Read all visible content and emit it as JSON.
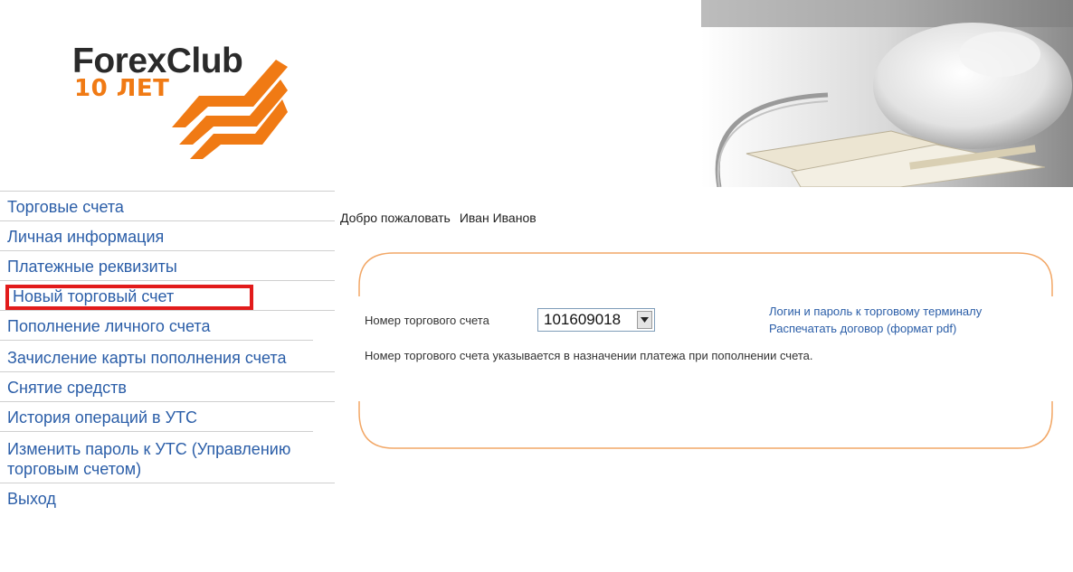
{
  "logo": {
    "brand": "ForexClub",
    "tagline": "10 ЛЕТ"
  },
  "sidebar": {
    "items": [
      {
        "label": "Торговые счета"
      },
      {
        "label": "Личная информация"
      },
      {
        "label": "Платежные реквизиты"
      },
      {
        "label": "Новый торговый счет"
      },
      {
        "label": "Пополнение личного счета"
      },
      {
        "label": "Зачисление карты пополнения счета"
      },
      {
        "label": "Снятие средств"
      },
      {
        "label": "История операций в УТС"
      },
      {
        "label": "Изменить пароль к УТС (Управлению торговым счетом)"
      },
      {
        "label": "Выход"
      }
    ]
  },
  "welcome": {
    "label": "Добро пожаловать",
    "user": "Иван Иванов"
  },
  "account": {
    "label": "Номер торгового счета",
    "selected": "101609018",
    "hint": "Номер торгового счета указывается в назначении платежа при пополнении счета."
  },
  "links": {
    "terminal": "Логин и пароль к торговому терминалу",
    "print": "Распечатать договор (формат pdf)"
  },
  "colors": {
    "link": "#2b5ea8",
    "accent_orange": "#f07a14",
    "highlight_red": "#e21b1b",
    "card_border": "#f2a766"
  },
  "icons": [
    "dropdown-arrow-icon",
    "forexclub-logo-stripes-icon"
  ]
}
